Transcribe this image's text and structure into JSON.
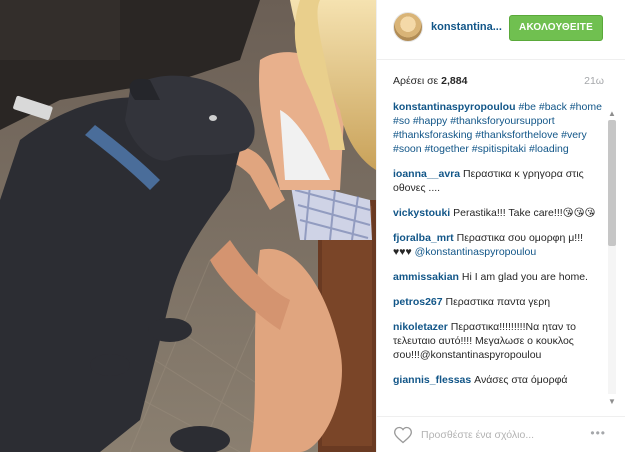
{
  "post": {
    "username": "konstantina...",
    "follow_label": "ΑΚΟΛΟΥΘΕΙΤΕ",
    "likes_label": "Αρέσει σε",
    "likes_count": "2,884",
    "timestamp": "21ω",
    "caption": {
      "author": "konstantinaspyropoulou",
      "text": "#be #back #home #so #happy #thanksforyoursupport #thanksforasking #thanksforthelove #very #soon #together #spitispitaki #loading"
    }
  },
  "comments": [
    {
      "author": "ioanna__avra",
      "text": "Περαστικα κ γρηγορα στις οθονες ...."
    },
    {
      "author": "vickystouki",
      "text": "Perastika!!! Take care!!!😘😘😘"
    },
    {
      "author": "fjoralba_mrt",
      "text": "Περαστικα σου ομορφη μ!!! ♥♥♥",
      "mention": "@konstantinaspyropoulou"
    },
    {
      "author": "ammissakian",
      "text": "Hi I am glad you are home."
    },
    {
      "author": "petros267",
      "text": "Περαστικα παντα γερη"
    },
    {
      "author": "nikoletazer",
      "text": "Περαστικα!!!!!!!!!Να ηταν το τελευταιο αυτό!!!! Μεγαλωσε ο κουκλος σου!!!@konstantinaspyropoulou"
    },
    {
      "author": "giannis_flessas",
      "text": "Ανάσες στα όμορφά"
    }
  ],
  "footer": {
    "placeholder": "Προσθέστε ένα σχόλιο...",
    "more": "•••"
  }
}
